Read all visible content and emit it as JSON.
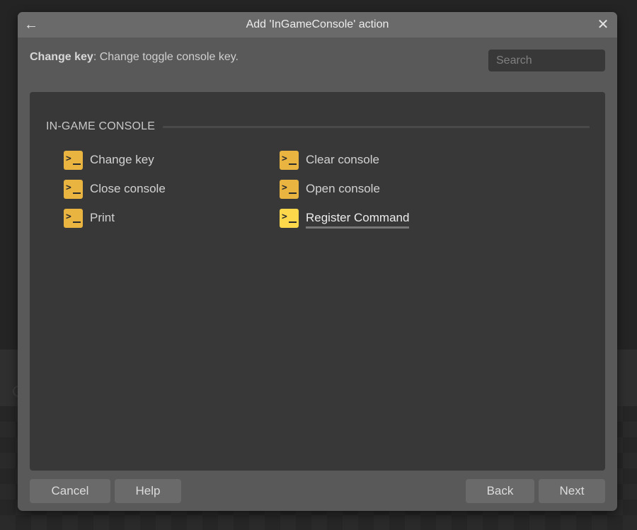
{
  "dialog": {
    "title": "Add 'InGameConsole' action",
    "back_icon": "arrow-left-icon",
    "close_icon": "close-icon"
  },
  "description": {
    "action_name": "Change key",
    "separator": ": ",
    "text": "Change toggle console key."
  },
  "search": {
    "placeholder": "Search",
    "value": ""
  },
  "section": {
    "title": "IN-GAME CONSOLE",
    "actions": [
      {
        "label": "Change key",
        "icon": "terminal-icon",
        "highlighted": false
      },
      {
        "label": "Clear console",
        "icon": "terminal-icon",
        "highlighted": false
      },
      {
        "label": "Close console",
        "icon": "terminal-icon",
        "highlighted": false
      },
      {
        "label": "Open console",
        "icon": "terminal-icon",
        "highlighted": false
      },
      {
        "label": "Print",
        "icon": "terminal-icon",
        "highlighted": false
      },
      {
        "label": "Register Command",
        "icon": "terminal-icon",
        "highlighted": true
      }
    ]
  },
  "icon_glyphs": {
    "prompt": ">",
    "back": "←",
    "close": "✕"
  },
  "colors": {
    "icon_default": "#e9b440",
    "icon_highlight": "#fcd84a"
  },
  "buttons": {
    "cancel": "Cancel",
    "help": "Help",
    "back": "Back",
    "next": "Next"
  }
}
